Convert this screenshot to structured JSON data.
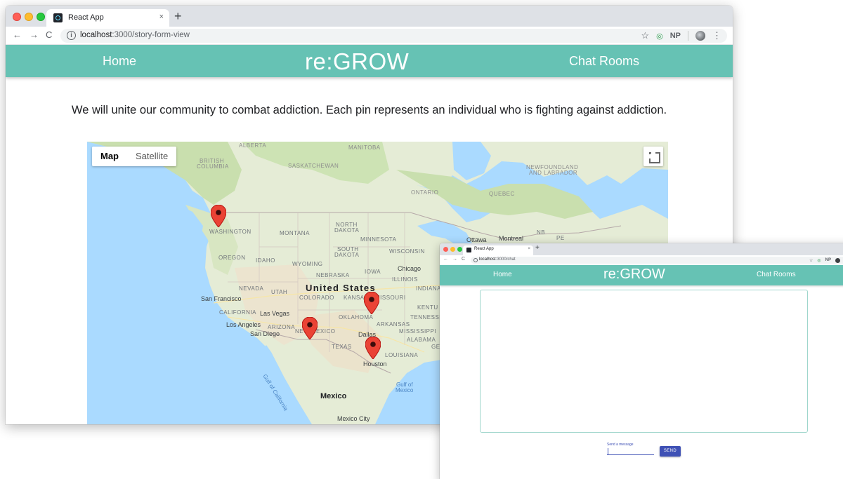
{
  "main_window": {
    "tab_title": "React App",
    "tab_close": "×",
    "new_tab": "+",
    "nav": {
      "back": "←",
      "forward": "→",
      "reload": "C"
    },
    "info": "i",
    "url_host": "localhost",
    "url_rest": ":3000/story-form-view",
    "star": "☆",
    "ext_np": "NP",
    "menu": "⋮",
    "navbar": {
      "home": "Home",
      "brand": "re:GROW",
      "chat_rooms": "Chat Rooms"
    },
    "tagline": "We will unite our community to combat addiction. Each pin represents an individual who is fighting against addiction.",
    "map": {
      "type_map": "Map",
      "type_satellite": "Satellite",
      "labels": {
        "alberta": "ALBERTA",
        "manitoba": "MANITOBA",
        "british_columbia_1": "BRITISH",
        "british_columbia_2": "COLUMBIA",
        "saskatchewan": "SASKATCHEWAN",
        "newfoundland_1": "NEWFOUNDLAND",
        "newfoundland_2": "AND LABRADOR",
        "ontario": "ONTARIO",
        "quebec": "QUEBEC",
        "washington": "WASHINGTON",
        "montana": "MONTANA",
        "north_dakota_1": "NORTH",
        "north_dakota_2": "DAKOTA",
        "minnesota": "MINNESOTA",
        "ottawa": "Ottawa",
        "montreal": "Montreal",
        "nb": "NB",
        "pe": "PE",
        "oregon": "OREGON",
        "idaho": "IDAHO",
        "wyoming": "WYOMING",
        "south_dakota_1": "SOUTH",
        "south_dakota_2": "DAKOTA",
        "wisconsin": "WISCONSIN",
        "nebraska": "NEBRASKA",
        "iowa": "IOWA",
        "chicago": "Chicago",
        "illinois": "ILLINOIS",
        "nevada": "NEVADA",
        "utah": "UTAH",
        "united_states": "United States",
        "colorado": "COLORADO",
        "kansas": "KANSAS",
        "missouri": "MISSOURI",
        "indiana": "INDIANA",
        "san_francisco": "San Francisco",
        "california": "CALIFORNIA",
        "las_vegas": "Las Vegas",
        "kentucky": "KENTU",
        "oklahoma": "OKLAHOMA",
        "tennessee": "TENNESSE",
        "los_angeles": "Los Angeles",
        "arizona": "ARIZONA",
        "new_mexico": "NEW MEXICO",
        "arkansas": "ARKANSAS",
        "san_diego": "San Diego",
        "dallas": "Dallas",
        "mississippi": "MISSISSIPPI",
        "texas": "TEXAS",
        "alabama": "ALABAMA",
        "ga": "GE",
        "louisiana": "LOUISIANA",
        "houston": "Houston",
        "gulf_of_california": "Gulf of California",
        "gulf_of_mexico_1": "Gulf of",
        "gulf_of_mexico_2": "Mexico",
        "mexico": "Mexico",
        "mexico_city": "Mexico City"
      },
      "pins": [
        "Washington",
        "Kansas/Missouri",
        "New Mexico",
        "Houston"
      ],
      "pin_color": "#ea4335"
    }
  },
  "chat_window": {
    "tab_title": "React App",
    "tab_close": "×",
    "new_tab": "+",
    "url_host": "localhost",
    "url_rest": ":3000/chat",
    "star": "☆",
    "ext_np": "NP",
    "menu": "⋮",
    "navbar": {
      "home": "Home",
      "brand": "re:GROW",
      "chat_rooms": "Chat Rooms"
    },
    "message_field_label": "Send a message",
    "message_value": "",
    "send_label": "SEND"
  },
  "colors": {
    "navbar": "#66c2b4",
    "send_button": "#3f51b5",
    "water": "#aadaff",
    "land": "#e5ecd6",
    "forest": "#c9dfae"
  }
}
